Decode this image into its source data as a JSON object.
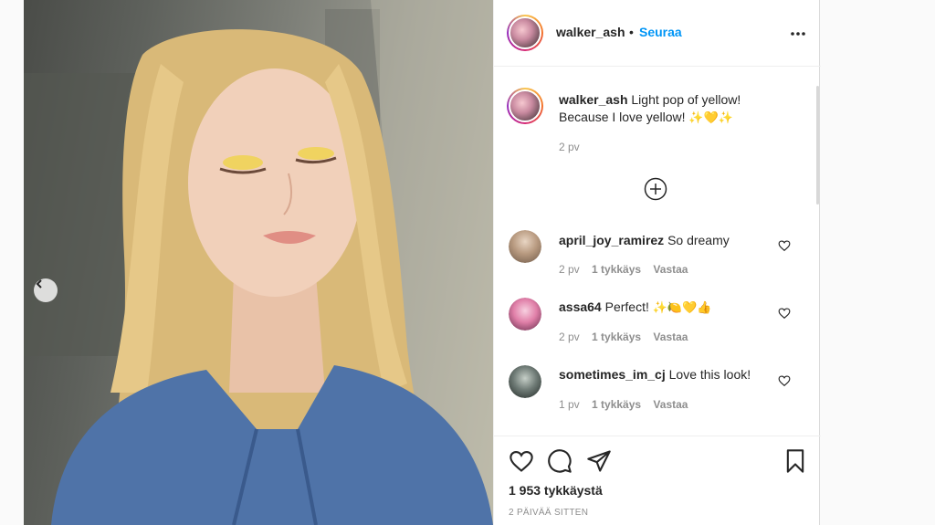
{
  "post": {
    "username": "walker_ash",
    "separator": "•",
    "follow_label": "Seuraa",
    "more_icon": "more-horizontal-icon"
  },
  "caption": {
    "username": "walker_ash",
    "text_line1": "Light pop of yellow!",
    "text_line2": "Because I love yellow!",
    "emoji": "✨💛✨",
    "age": "2 pv"
  },
  "comments": [
    {
      "username": "april_joy_ramirez",
      "text": "So dreamy",
      "emoji": "",
      "age": "2 pv",
      "likes": "1 tykkäys",
      "reply": "Vastaa"
    },
    {
      "username": "assa64",
      "text": "Perfect!",
      "emoji": "✨🍋💛👍",
      "age": "2 pv",
      "likes": "1 tykkäys",
      "reply": "Vastaa"
    },
    {
      "username": "sometimes_im_cj",
      "text": "Love this look!",
      "emoji": "",
      "age": "1 pv",
      "likes": "1 tykkäys",
      "reply": "Vastaa"
    }
  ],
  "footer": {
    "likes": "1 953 tykkäystä",
    "timestamp": "2 PÄIVÄÄ SITTEN"
  },
  "colors": {
    "accent": "#0095f6",
    "muted": "#8e8e8e",
    "text": "#262626"
  }
}
